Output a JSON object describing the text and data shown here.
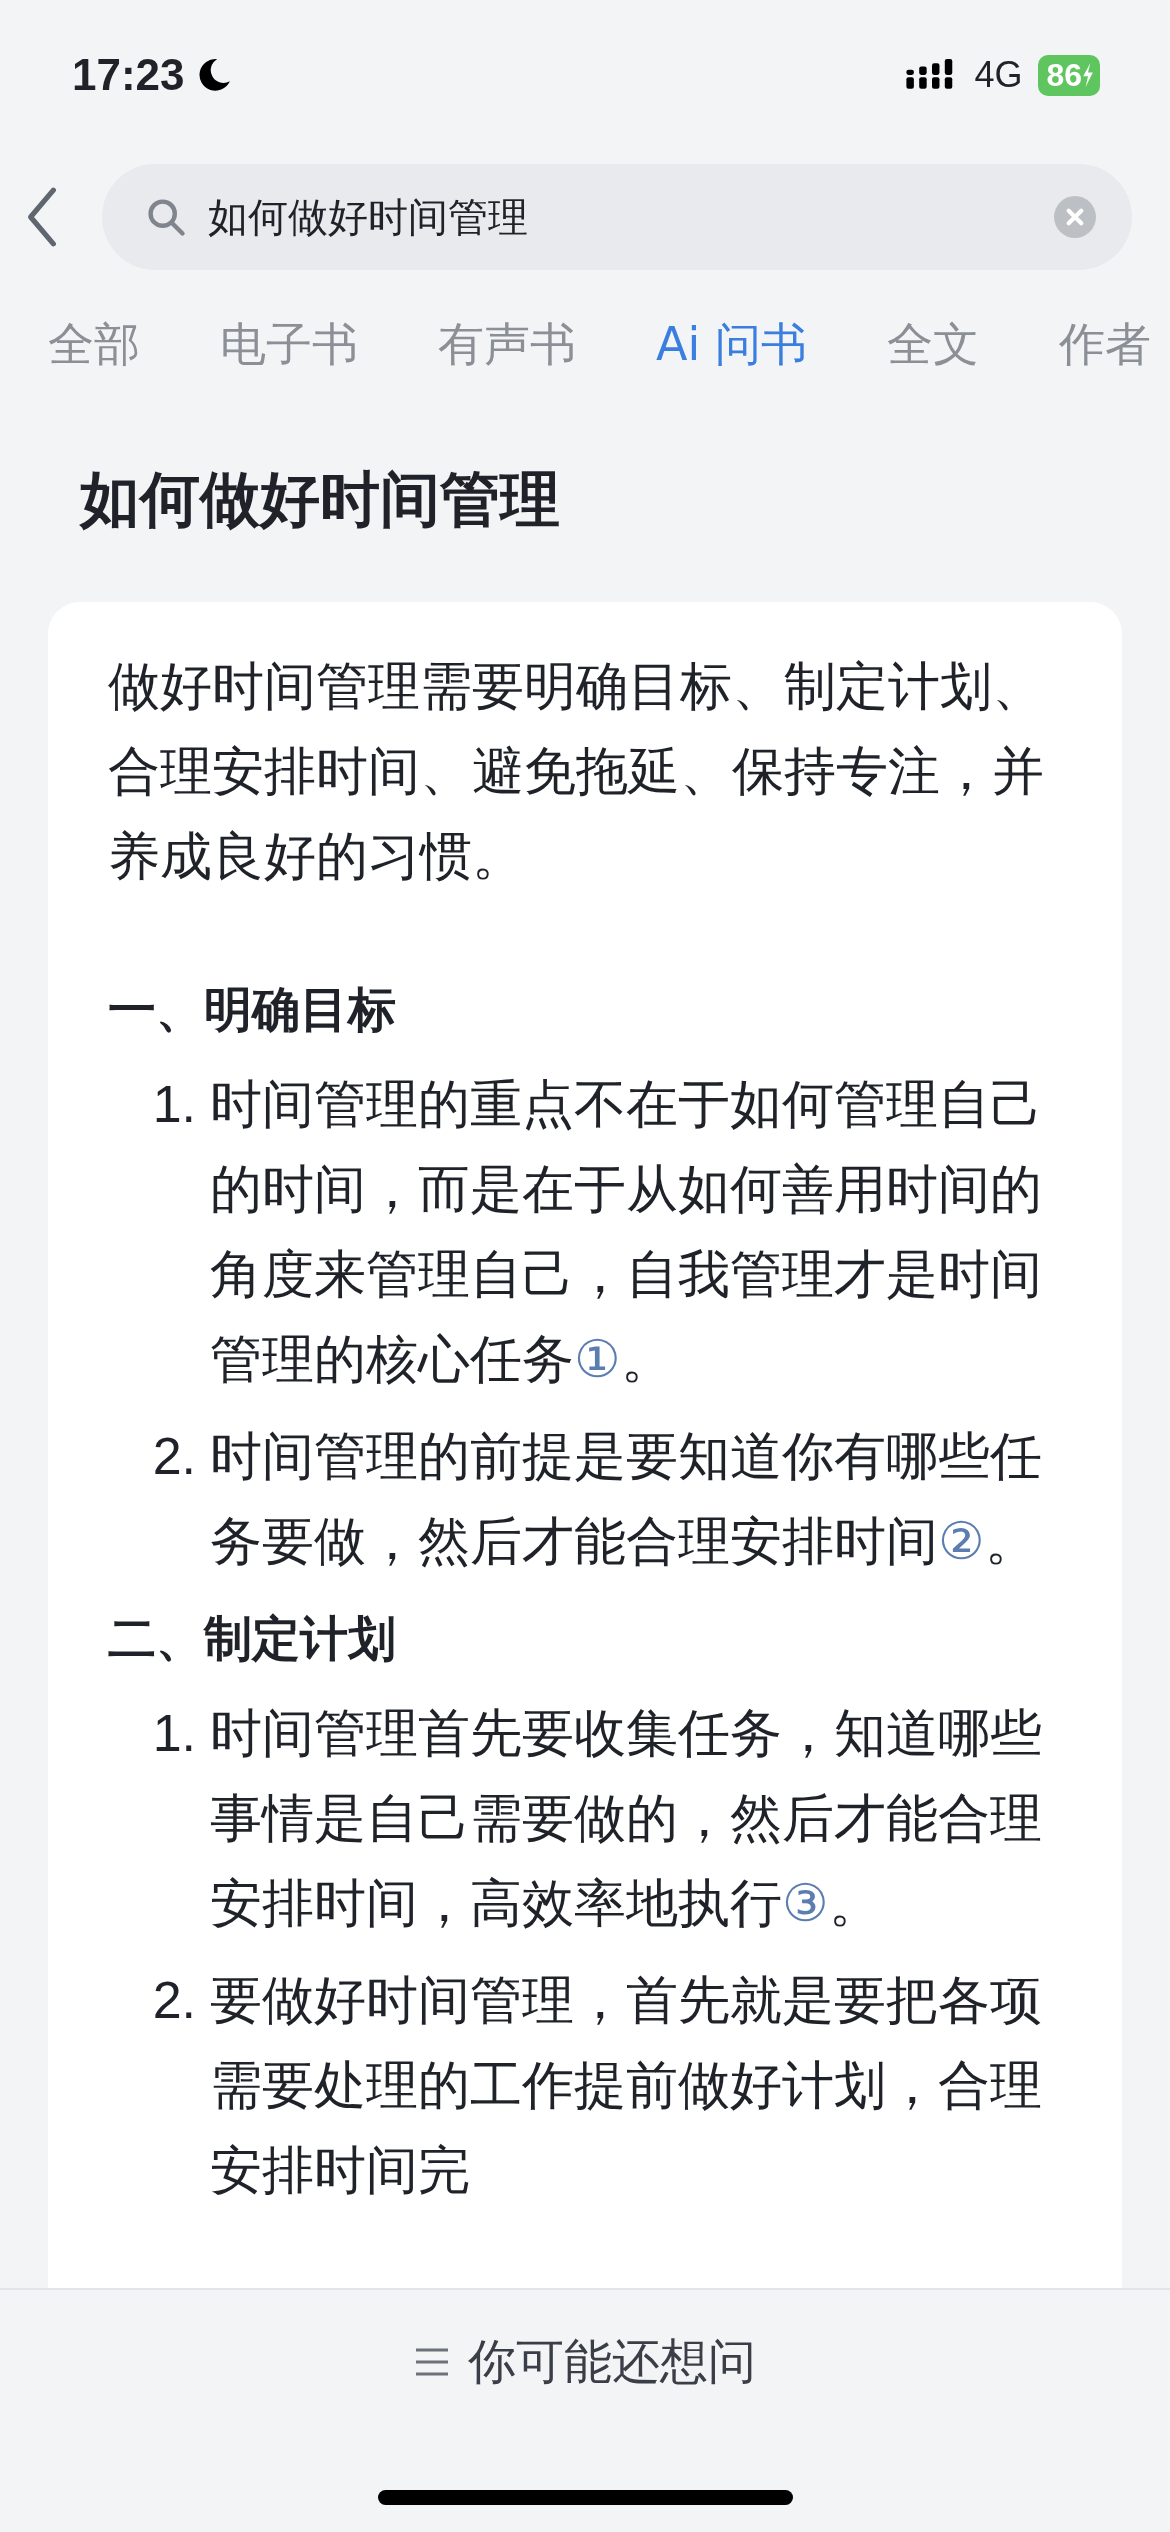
{
  "status_bar": {
    "time": "17:23",
    "network": "4G",
    "battery": "86"
  },
  "search": {
    "value": "如何做好时间管理"
  },
  "tabs": [
    {
      "label": "全部",
      "selected": false
    },
    {
      "label": "电子书",
      "selected": false
    },
    {
      "label": "有声书",
      "selected": false
    },
    {
      "label": "Ai 问书",
      "selected": true
    },
    {
      "label": "全文",
      "selected": false
    },
    {
      "label": "作者",
      "selected": false
    }
  ],
  "question": "如何做好时间管理",
  "answer": {
    "summary": "做好时间管理需要明确目标、制定计划、合理安排时间、避免拖延、保持专注，并养成良好的习惯。",
    "sections": [
      {
        "heading": "一、明确目标",
        "items": [
          {
            "number": "1.",
            "text": "时间管理的重点不在于如何管理自己的时间，而是在于从如何善用时间的角度来管理自己，自我管理才是时间管理的核心任务",
            "note": "①",
            "end": "。"
          },
          {
            "number": "2.",
            "text": "时间管理的前提是要知道你有哪些任务要做，然后才能合理安排时间",
            "note": "②",
            "end": "。"
          }
        ]
      },
      {
        "heading": "二、制定计划",
        "items": [
          {
            "number": "1.",
            "text": "时间管理首先要收集任务，知道哪些事情是自己需要做的，然后才能合理安排时间，高效率地执行",
            "note": "③",
            "end": "。"
          },
          {
            "number": "2.",
            "text": "要做好时间管理，首先就是要把各项需要处理的工作提前做好计划，合理安排时间完"
          }
        ]
      }
    ]
  },
  "bottom_bar": {
    "label": "你可能还想问"
  }
}
